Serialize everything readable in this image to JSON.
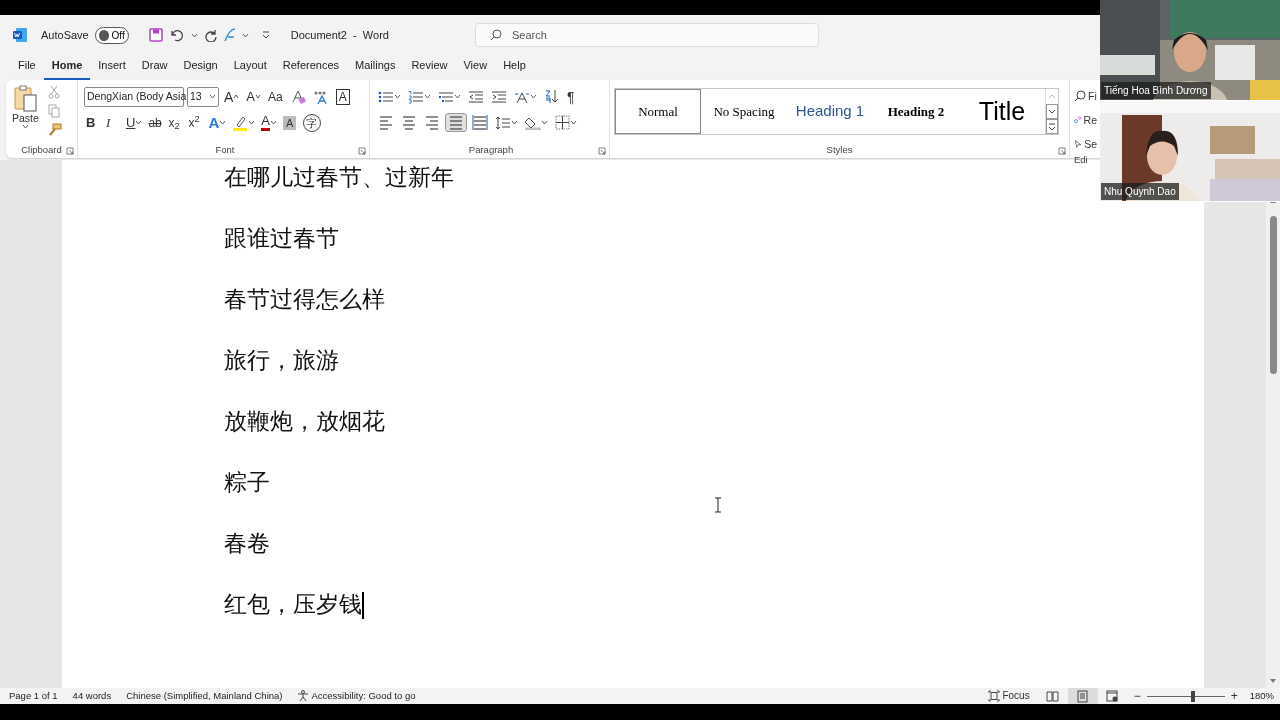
{
  "title_bar": {
    "autosave_label": "AutoSave",
    "autosave_toggle": {
      "label": "Off",
      "on": false
    },
    "document_title": "Document2  -  Word",
    "search": {
      "placeholder": "Search"
    }
  },
  "menu_tabs": [
    {
      "label": "File",
      "selected": false
    },
    {
      "label": "Home",
      "selected": true
    },
    {
      "label": "Insert",
      "selected": false
    },
    {
      "label": "Draw",
      "selected": false
    },
    {
      "label": "Design",
      "selected": false
    },
    {
      "label": "Layout",
      "selected": false
    },
    {
      "label": "References",
      "selected": false
    },
    {
      "label": "Mailings",
      "selected": false
    },
    {
      "label": "Review",
      "selected": false
    },
    {
      "label": "View",
      "selected": false
    },
    {
      "label": "Help",
      "selected": false
    }
  ],
  "ribbon": {
    "clipboard": {
      "paste_label": "Paste",
      "group_label": "Clipboard"
    },
    "font": {
      "font_name": "DengXian (Body Asia",
      "font_size": "13",
      "group_label": "Font",
      "row_1": [
        {
          "kind": "grow",
          "text": "A"
        },
        {
          "kind": "shrink",
          "text": "A"
        },
        {
          "kind": "case",
          "text": "Aa"
        },
        {
          "kind": "clear"
        },
        {
          "kind": "phonetic"
        },
        {
          "kind": "border",
          "text": "A"
        }
      ],
      "row_2": [
        {
          "kind": "bold",
          "text": "B"
        },
        {
          "kind": "italic",
          "text": "I"
        },
        {
          "kind": "underline",
          "text": "U"
        },
        {
          "kind": "strike",
          "text": "ab"
        },
        {
          "kind": "script",
          "text": "x$_{2}$"
        },
        {
          "kind": "script",
          "text": "x$^{2}$"
        },
        {
          "kind": "effects",
          "text": "A"
        },
        {
          "kind": "highlight"
        },
        {
          "kind": "color",
          "text": "A"
        },
        {
          "kind": "shading",
          "text": "A"
        },
        {
          "kind": "enclose",
          "text": "字"
        }
      ]
    },
    "paragraph": {
      "group_label": "Paragraph",
      "pilcrow": "¶",
      "alignment": [
        {
          "kind": "left",
          "selected": false
        },
        {
          "kind": "center",
          "selected": false
        },
        {
          "kind": "right",
          "selected": false
        },
        {
          "kind": "justify",
          "selected": true
        },
        {
          "kind": "distributed",
          "selected": false
        }
      ]
    },
    "styles": {
      "group_label": "Styles",
      "items": [
        {
          "label": "Normal",
          "kind": "normal",
          "selected": true
        },
        {
          "label": "No Spacing",
          "kind": "plain",
          "selected": false
        },
        {
          "label": "Heading 1",
          "kind": "heading1",
          "selected": false
        },
        {
          "label": "Heading 2",
          "kind": "heading2",
          "selected": false
        },
        {
          "label": "Title",
          "kind": "title",
          "selected": false
        }
      ]
    },
    "editing": {
      "items": [
        "Fi",
        "Re",
        "Se"
      ],
      "group_label": "Edi"
    }
  },
  "document": {
    "lines": [
      "在哪儿过春节、过新年",
      "跟谁过春节",
      "春节过得怎么样",
      "旅行，旅游",
      "放鞭炮，放烟花",
      "粽子",
      "春卷",
      "红包，压岁钱"
    ]
  },
  "video_tiles": [
    {
      "name": "Tiếng Hoa Bình Dương",
      "kind": "picture"
    },
    {
      "name": "Nhu Quynh Dao",
      "kind": "picture"
    }
  ],
  "status_bar": {
    "page": "Page 1 of 1",
    "words": "44 words",
    "language": "Chinese (Simplified, Mainland China)",
    "accessibility": "Accessibility: Good to go",
    "focus": "Focus",
    "views": [
      {
        "kind": "read",
        "selected": false
      },
      {
        "kind": "print",
        "selected": true
      },
      {
        "kind": "web",
        "selected": false
      }
    ],
    "zoom": {
      "minus": "−",
      "plus": "+",
      "level": 0.59,
      "reading": "180%"
    }
  }
}
